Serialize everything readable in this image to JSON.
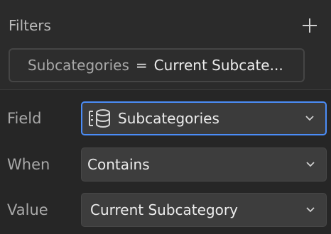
{
  "header": {
    "title": "Filters",
    "add_icon": "plus-icon"
  },
  "active_filter": {
    "field": "Subcategories",
    "operator": "=",
    "value": "Current Subcate..."
  },
  "form": {
    "field": {
      "label": "Field",
      "value": "Subcategories",
      "icon": "list-database-icon"
    },
    "when": {
      "label": "When",
      "value": "Contains"
    },
    "value": {
      "label": "Value",
      "value": "Current Subcategory"
    }
  },
  "colors": {
    "background": "#2b2b2b",
    "panel": "#262626",
    "select_bg": "#3d3d3d",
    "focus_ring": "#4b8df8"
  }
}
